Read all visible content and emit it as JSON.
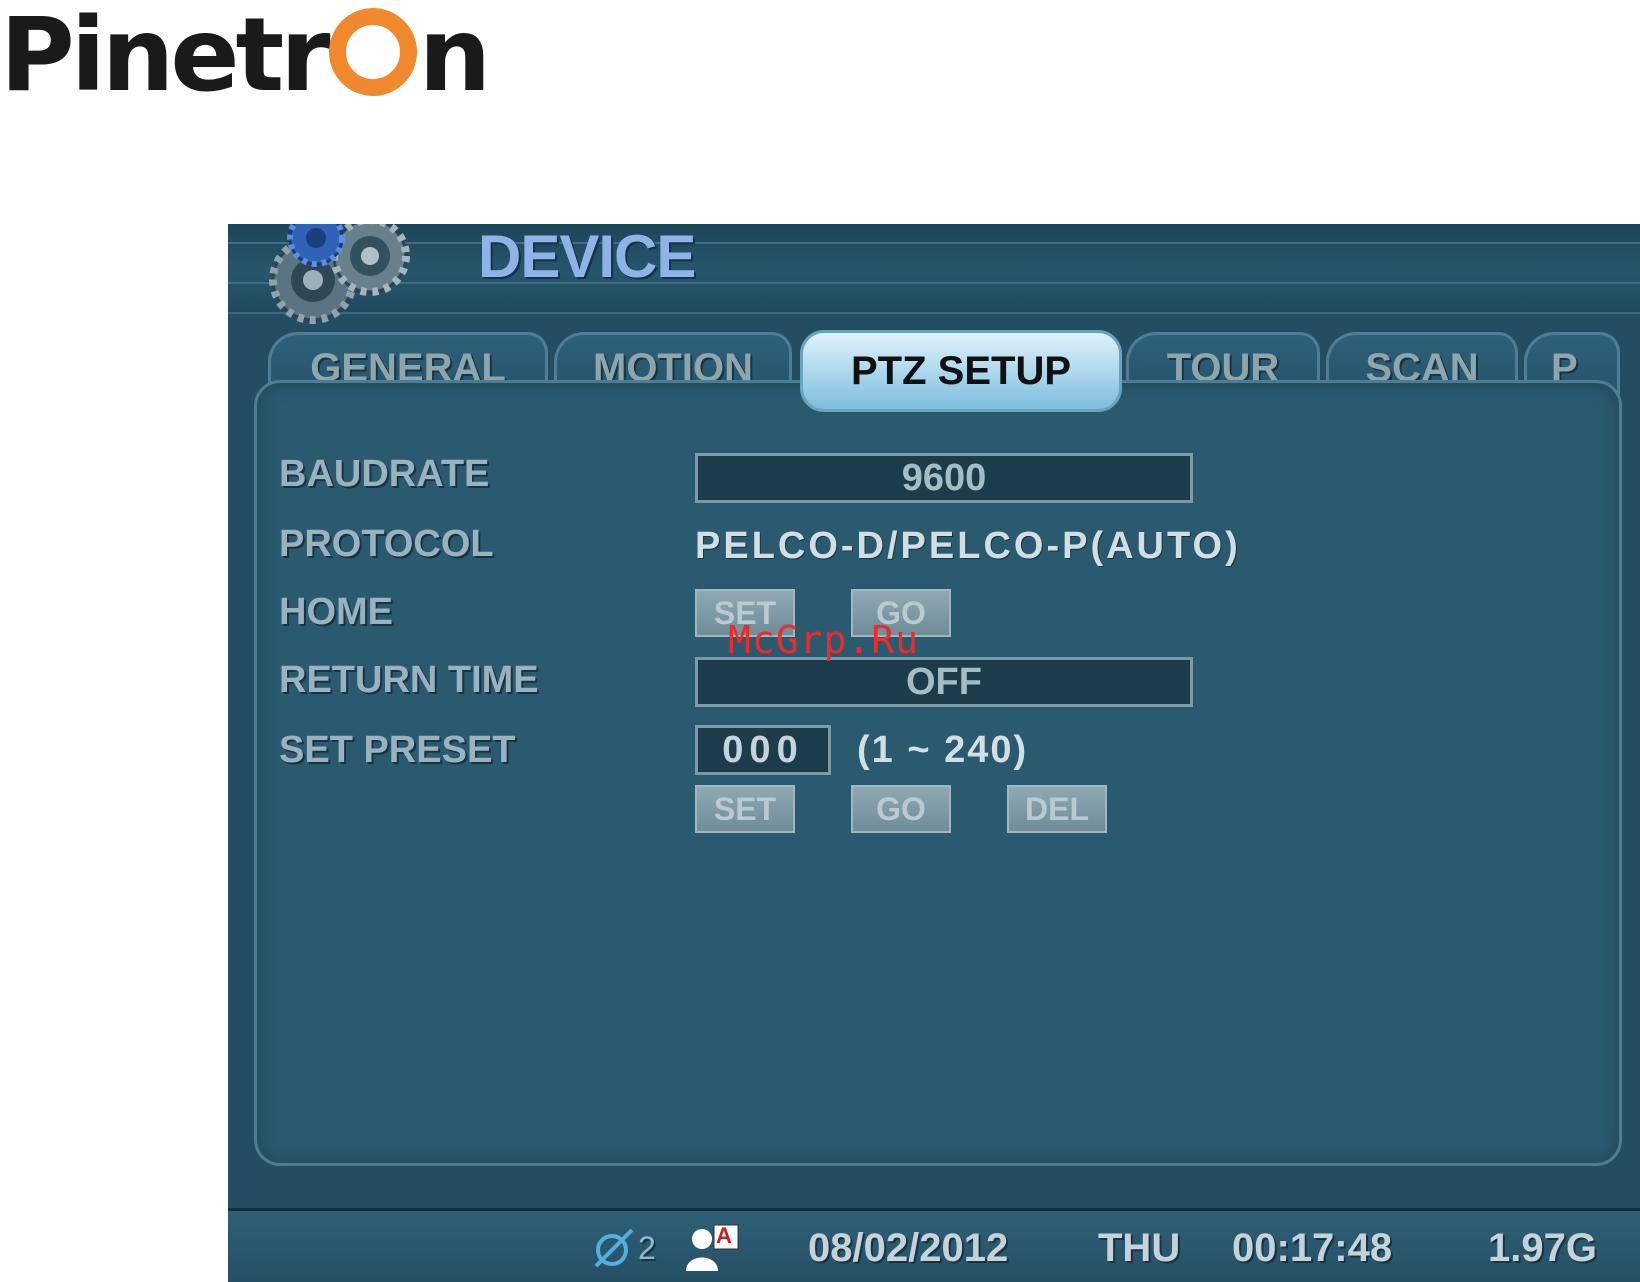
{
  "brand": {
    "prefix": "Pinetr",
    "suffix": "n",
    "accent_color": "#f0892e"
  },
  "header": {
    "title": "DEVICE",
    "icon": "gears-icon"
  },
  "tabs": [
    {
      "label": "GENERAL"
    },
    {
      "label": "MOTION"
    },
    {
      "label": "PTZ SETUP",
      "active": true
    },
    {
      "label": "TOUR"
    },
    {
      "label": "SCAN"
    },
    {
      "label": "P"
    }
  ],
  "settings": {
    "baudrate": {
      "label": "BAUDRATE",
      "value": "9600"
    },
    "protocol": {
      "label": "PROTOCOL",
      "value": "PELCO-D/PELCO-P(AUTO)"
    },
    "home": {
      "label": "HOME",
      "set_label": "SET",
      "go_label": "GO"
    },
    "return_time": {
      "label": "RETURN TIME",
      "value": "OFF"
    },
    "set_preset": {
      "label": "SET PRESET",
      "value": "000",
      "range": "(1 ~ 240)",
      "set_label": "SET",
      "go_label": "GO",
      "del_label": "DEL"
    }
  },
  "watermark": "McGrp.Ru",
  "status_bar": {
    "channel_count": "2",
    "user_badge": "A",
    "date": "08/02/2012",
    "day": "THU",
    "time": "00:17:48",
    "storage": "1.97G",
    "icons": [
      "network-icon",
      "user-icon"
    ]
  },
  "colors": {
    "screen_bg": "#234d62",
    "panel_bg": "#2a5a70",
    "active_tab": "#a9d6ec",
    "title": "#8fb2e8",
    "watermark": "#ee2a2a"
  }
}
